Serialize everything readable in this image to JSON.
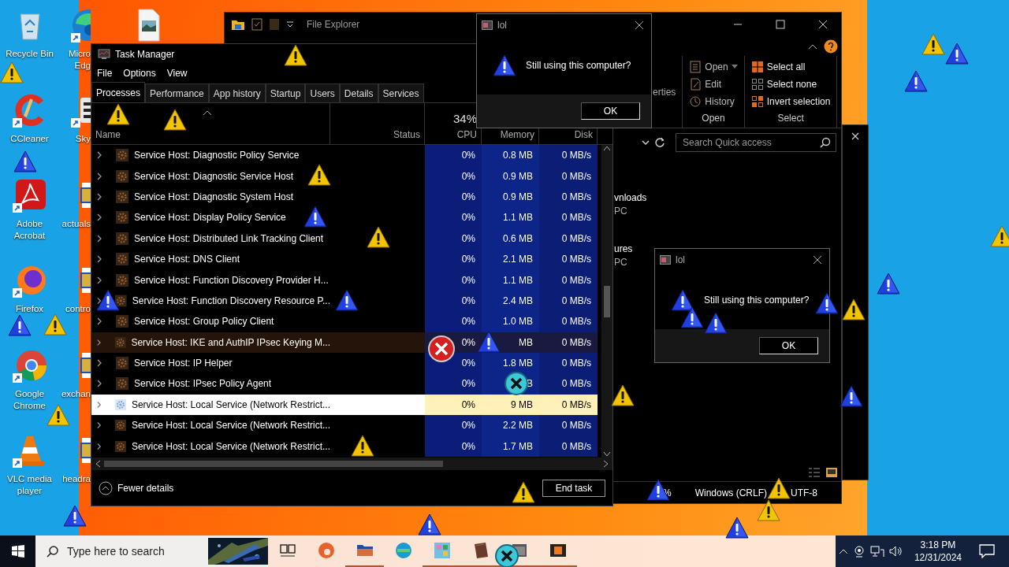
{
  "desktop_icons": [
    {
      "lines": [
        "Recycle Bin"
      ]
    },
    {
      "lines": [
        "CCleaner"
      ]
    },
    {
      "lines": [
        "Adobe",
        "Acrobat"
      ]
    },
    {
      "lines": [
        "Firefox"
      ]
    },
    {
      "lines": [
        "Google",
        "Chrome"
      ]
    },
    {
      "lines": [
        "VLC media",
        "player"
      ]
    },
    {
      "lines": [
        "Micro",
        "Edg"
      ]
    },
    {
      "lines": [
        "Sky"
      ]
    },
    {
      "lines": [
        "actuals"
      ]
    },
    {
      "lines": [
        "contro"
      ]
    },
    {
      "lines": [
        "exchan"
      ]
    },
    {
      "lines": [
        "headra"
      ]
    }
  ],
  "file_explorer": {
    "title": "File Explorer",
    "ribbon": {
      "properties_fragment": "erties",
      "groups": [
        {
          "label": "Open",
          "items": [
            "Open",
            "Edit",
            "History"
          ]
        },
        {
          "label": "Select",
          "items": [
            "Select all",
            "Select none",
            "Invert selection"
          ]
        }
      ]
    },
    "search": {
      "placeholder": "Search Quick access"
    },
    "items": [
      {
        "name": "vnloads",
        "location": "PC"
      },
      {
        "name": "ures",
        "location": "PC"
      }
    ],
    "status_bar": [
      "%",
      "Windows (CRLF)",
      "UTF-8"
    ]
  },
  "task_manager": {
    "title": "Task Manager",
    "menu": [
      "File",
      "Options",
      "View"
    ],
    "tabs": [
      {
        "label": "Processes",
        "selected": true
      },
      {
        "label": "Performance",
        "selected": false
      },
      {
        "label": "App history",
        "selected": false
      },
      {
        "label": "Startup",
        "selected": false
      },
      {
        "label": "Users",
        "selected": false
      },
      {
        "label": "Details",
        "selected": false
      },
      {
        "label": "Services",
        "selected": false
      }
    ],
    "cpu_total": "34%",
    "columns": [
      "Name",
      "Status",
      "CPU",
      "Memory",
      "Disk"
    ],
    "rows": [
      {
        "name": "Service Host: Diagnostic Policy Service",
        "cpu": "0%",
        "memory": "0.8 MB",
        "disk": "0 MB/s",
        "selected": false,
        "highlighted": false
      },
      {
        "name": "Service Host: Diagnostic Service Host",
        "cpu": "0%",
        "memory": "0.9 MB",
        "disk": "0 MB/s",
        "selected": false,
        "highlighted": false
      },
      {
        "name": "Service Host: Diagnostic System Host",
        "cpu": "0%",
        "memory": "0.9 MB",
        "disk": "0 MB/s",
        "selected": false,
        "highlighted": false
      },
      {
        "name": "Service Host: Display Policy Service",
        "cpu": "0%",
        "memory": "1.1 MB",
        "disk": "0 MB/s",
        "selected": false,
        "highlighted": false
      },
      {
        "name": "Service Host: Distributed Link Tracking Client",
        "cpu": "0%",
        "memory": "0.6 MB",
        "disk": "0 MB/s",
        "selected": false,
        "highlighted": false
      },
      {
        "name": "Service Host: DNS Client",
        "cpu": "0%",
        "memory": "2.1 MB",
        "disk": "0 MB/s",
        "selected": false,
        "highlighted": false
      },
      {
        "name": "Service Host: Function Discovery Provider H...",
        "cpu": "0%",
        "memory": "1.1 MB",
        "disk": "0 MB/s",
        "selected": false,
        "highlighted": false
      },
      {
        "name": "Service Host: Function Discovery Resource P...",
        "cpu": "0%",
        "memory": "2.4 MB",
        "disk": "0 MB/s",
        "selected": false,
        "highlighted": false
      },
      {
        "name": "Service Host: Group Policy Client",
        "cpu": "0%",
        "memory": "1.0 MB",
        "disk": "0 MB/s",
        "selected": false,
        "highlighted": false
      },
      {
        "name": "Service Host: IKE and AuthIP IPsec Keying M...",
        "cpu": "0%",
        "memory": "MB",
        "disk": "0 MB/s",
        "selected": false,
        "highlighted": true
      },
      {
        "name": "Service Host: IP Helper",
        "cpu": "0%",
        "memory": "1.8 MB",
        "disk": "0 MB/s",
        "selected": false,
        "highlighted": false
      },
      {
        "name": "Service Host: IPsec Policy Agent",
        "cpu": "0%",
        "memory": "B",
        "disk": "0 MB/s",
        "selected": false,
        "highlighted": false
      },
      {
        "name": "Service Host: Local Service (Network Restrict...",
        "cpu": "0%",
        "memory": "9 MB",
        "disk": "0 MB/s",
        "selected": true,
        "highlighted": false
      },
      {
        "name": "Service Host: Local Service (Network Restrict...",
        "cpu": "0%",
        "memory": "2.2 MB",
        "disk": "0 MB/s",
        "selected": false,
        "highlighted": false
      },
      {
        "name": "Service Host: Local Service (Network Restrict...",
        "cpu": "0%",
        "memory": "1.7 MB",
        "disk": "0 MB/s",
        "selected": false,
        "highlighted": false
      }
    ],
    "fewer_details": "Fewer details",
    "end_task": "End task"
  },
  "dialogs": [
    {
      "title": "lol",
      "message": "Still using this computer?",
      "button": "OK"
    },
    {
      "title": "lol",
      "message": "Still using this computer?",
      "button": "OK"
    }
  ],
  "taskbar": {
    "search_placeholder": "Type here to search",
    "time": "3:18 PM",
    "date": "12/31/2024"
  }
}
